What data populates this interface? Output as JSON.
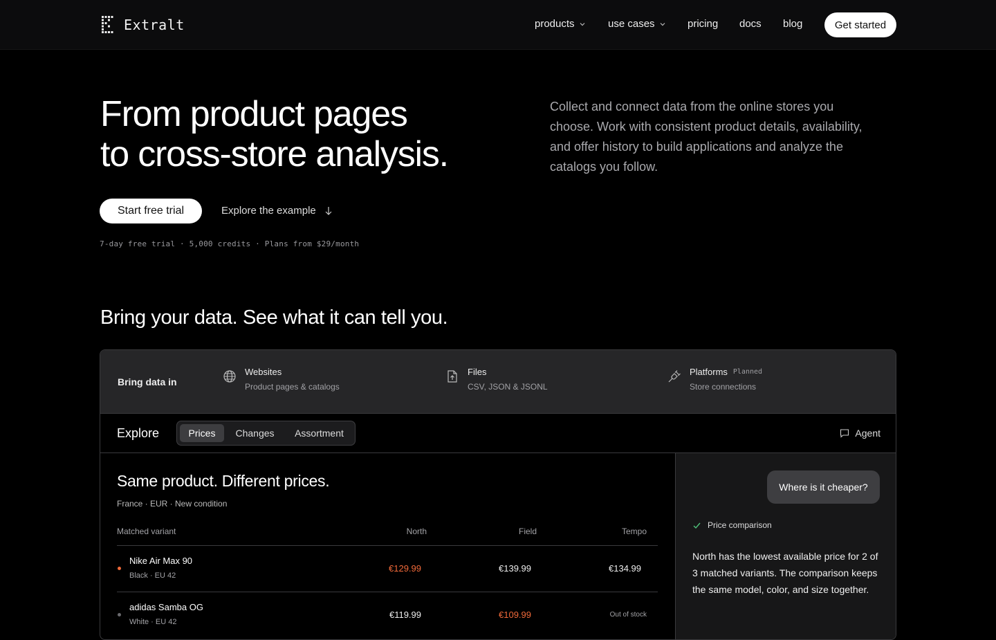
{
  "nav": {
    "brand": "Extralt",
    "links": [
      {
        "label": "products",
        "has_dropdown": true
      },
      {
        "label": "use cases",
        "has_dropdown": true
      },
      {
        "label": "pricing"
      },
      {
        "label": "docs"
      },
      {
        "label": "blog"
      }
    ],
    "cta": "Get started"
  },
  "hero": {
    "title_line1": "From product pages",
    "title_line2": "to cross-store analysis.",
    "description": "Collect and connect data from the online stores you choose. Work with consistent product details, availability, and offer history to build applications and analyze the catalogs you follow.",
    "primary_button": "Start free trial",
    "secondary_button": "Explore the example",
    "meta": "7-day free trial · 5,000 credits · Plans from $29/month"
  },
  "section": {
    "title": "Bring your data. See what it can tell you."
  },
  "bring": {
    "label": "Bring data in",
    "sources": [
      {
        "icon": "globe-icon",
        "title": "Websites",
        "subtitle": "Product pages & catalogs"
      },
      {
        "icon": "file-upload-icon",
        "title": "Files",
        "subtitle": "CSV, JSON & JSONL"
      },
      {
        "icon": "plug-icon",
        "title": "Platforms",
        "badge": "Planned",
        "subtitle": "Store connections"
      }
    ]
  },
  "explore": {
    "label": "Explore",
    "tabs": [
      "Prices",
      "Changes",
      "Assortment"
    ],
    "active_tab": "Prices",
    "agent_label": "Agent"
  },
  "comparison": {
    "title": "Same product. Different prices.",
    "subtitle": "France · EUR · New condition",
    "columns": [
      "Matched variant",
      "North",
      "Field",
      "Tempo"
    ],
    "rows": [
      {
        "name": "Nike Air Max 90",
        "detail": "Black · EU 42",
        "north": "€129.99",
        "field": "€139.99",
        "tempo": "€134.99",
        "lowest": "north",
        "dot_color": "#f26a3a"
      },
      {
        "name": "adidas Samba OG",
        "detail": "White · EU 42",
        "north": "€119.99",
        "field": "€109.99",
        "tempo": "Out of stock",
        "lowest": "field",
        "dot_color": "#6a6a6e"
      }
    ]
  },
  "chat": {
    "question": "Where is it cheaper?",
    "tool_label": "Price comparison",
    "answer": "North has the lowest available price for 2 of 3 matched variants. The comparison keeps the same model, color, and size together."
  },
  "colors": {
    "accent_low_price": "#f26a3a",
    "background": "#000000",
    "panel": "#262628"
  }
}
